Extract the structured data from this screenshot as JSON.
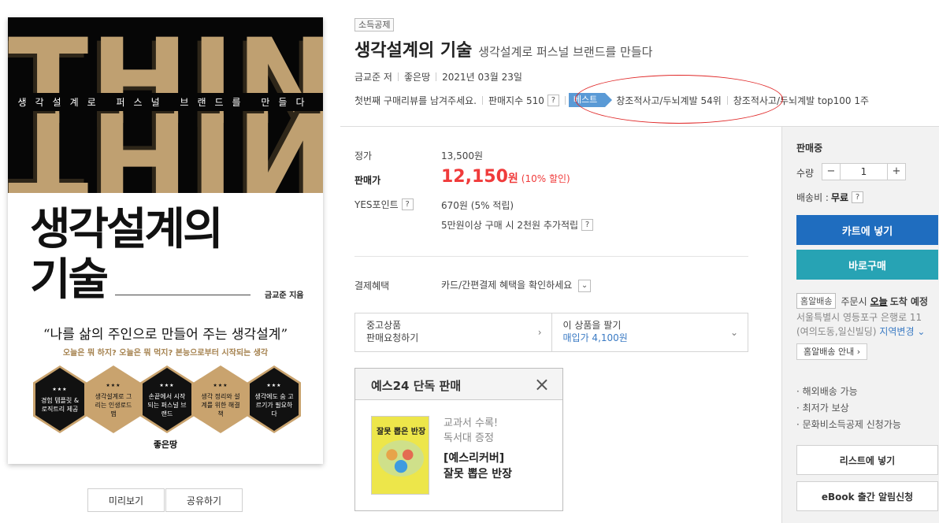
{
  "cover": {
    "think_word": "THINK",
    "subtitle": "생각설계로 퍼스널 브랜드를 만들다",
    "title_line1": "생각설계의",
    "title_line2": "기술",
    "author": "금교준 지음",
    "quote": "“나를 삶의 주인으로 만들어 주는 생각설계”",
    "tagline": "오늘은 뭐 하지? 오늘은 뭐 먹지? 본능으로부터 시작되는 생각",
    "hexes": [
      {
        "stars": "★★★",
        "text": "경험 템플릿 &로직트리 제공"
      },
      {
        "stars": "★★★",
        "text": "생각설계로 그리는 인생로드맵"
      },
      {
        "stars": "★★★",
        "text": "손끝에서 시작되는 퍼스널 브랜드"
      },
      {
        "stars": "★★★",
        "text": "생각 정리와 설계를 위한 해결책"
      },
      {
        "stars": "★★★",
        "text": "생각에도 숨 고르기가 필요하다"
      }
    ],
    "publisher_logo": "좋은땅"
  },
  "cover_buttons": {
    "preview": "미리보기",
    "share": "공유하기"
  },
  "product": {
    "badge": "소득공제",
    "title": "생각설계의 기술",
    "subtitle": "생각설계로 퍼스널 브랜드를 만들다",
    "author": "금교준 저",
    "publisher": "좋은땅",
    "date": "2021년 03월 23일",
    "review_prompt": "첫번째 구매리뷰를 남겨주세요.",
    "sales_index": "판매지수 510",
    "help": "?",
    "best_label": "베스트",
    "best_rank": "창조적사고/두뇌계발 54위",
    "top100": "창조적사고/두뇌계발 top100 1주"
  },
  "price": {
    "list_label": "정가",
    "list_value": "13,500원",
    "sale_label": "판매가",
    "sale_value": "12,150",
    "sale_unit": "원",
    "discount": "(10% 할인)",
    "points_label": "YES포인트",
    "points_value": "670원 (5% 적립)",
    "extra_points": "5만원이상 구매 시 2천원 추가적립",
    "payment_label": "결제혜택",
    "payment_value": "카드/간편결제 혜택을 확인하세요"
  },
  "used": {
    "left_line1": "중고상품",
    "left_line2": "판매요청하기",
    "right_line1": "이 상품을 팔기",
    "right_line2": "매입가 4,100원"
  },
  "exclusive": {
    "header": "예스24 단독 판매",
    "book_title_img": "잘못 뽑은 반장",
    "sub_line1": "교과서 수록!",
    "sub_line2": "독서대 증정",
    "title_line1": "[예스리커버]",
    "title_line2": "잘못 뽑은 반장"
  },
  "panel": {
    "status": "판매중",
    "qty_label": "수량",
    "qty_value": "1",
    "minus": "−",
    "plus": "+",
    "ship_label": "배송비 :",
    "ship_value": "무료",
    "cart": "카트에 넣기",
    "buy": "바로구매",
    "deliv_tag": "홈알배송",
    "deliv_pre": "주문시",
    "deliv_today": "오늘",
    "deliv_post": "도착 예정",
    "addr_line1": "서울특별시 영등포구 은행로 11",
    "addr_line2": "(여의도동,일신빌딩)",
    "addr_change": "지역변경",
    "guide": "홈알배송 안내",
    "notes": [
      "· 해외배송 가능",
      "· 최저가 보상",
      "· 문화비소득공제 신청가능"
    ],
    "list_btn": "리스트에 넣기",
    "ebook_btn": "eBook 출간 알림신청"
  }
}
